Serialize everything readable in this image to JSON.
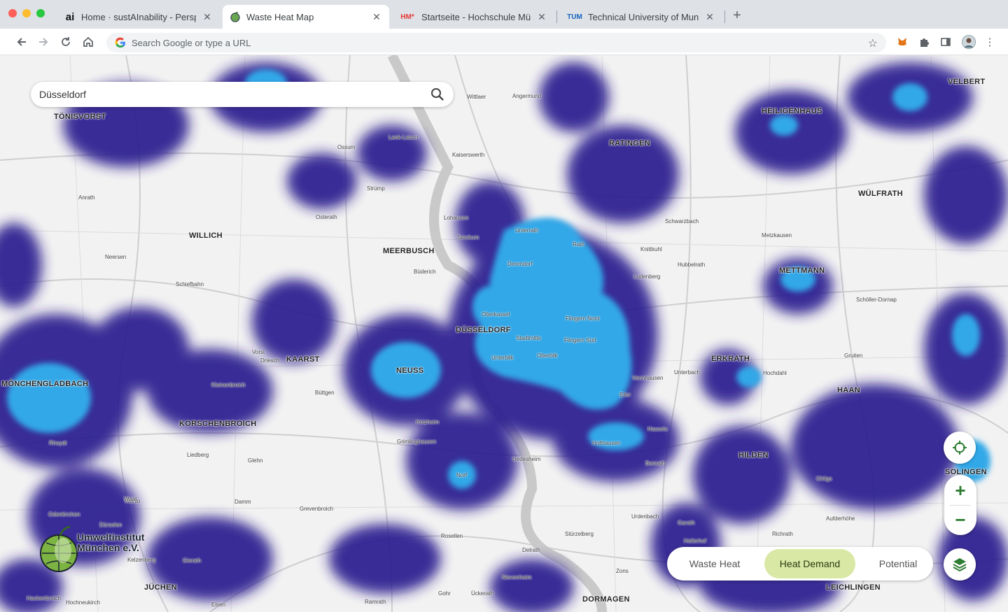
{
  "browser": {
    "tabs": [
      {
        "favicon": "ai",
        "title": "Home · sustAInability - Perspe",
        "active": false
      },
      {
        "favicon": "apple-icon",
        "title": "Waste Heat Map",
        "active": true
      },
      {
        "favicon": "HM*",
        "title": "Startseite - Hochschule Münc",
        "active": false
      },
      {
        "favicon": "TUM",
        "title": "Technical University of Munic",
        "active": false
      }
    ],
    "omnibox_placeholder": "Search Google or type a URL"
  },
  "map": {
    "search_value": "Düsseldorf",
    "places": [
      {
        "label": "TÖNISVORST",
        "cls": "big"
      },
      {
        "label": "WILLICH",
        "cls": "big"
      },
      {
        "label": "MEERBUSCH",
        "cls": "big"
      },
      {
        "label": "DÜSSELDORF",
        "cls": "big"
      },
      {
        "label": "NEUSS",
        "cls": "big"
      },
      {
        "label": "KAARST",
        "cls": "big"
      },
      {
        "label": "MÖNCHENGLADBACH",
        "cls": "big"
      },
      {
        "label": "KORSCHENBROICH",
        "cls": "big"
      },
      {
        "label": "RATINGEN",
        "cls": "big"
      },
      {
        "label": "HEILIGENHAUS",
        "cls": "big"
      },
      {
        "label": "VELBERT",
        "cls": "big"
      },
      {
        "label": "WÜLFRATH",
        "cls": "big"
      },
      {
        "label": "METTMANN",
        "cls": "big"
      },
      {
        "label": "ERKRATH",
        "cls": "big"
      },
      {
        "label": "HAAN",
        "cls": "big"
      },
      {
        "label": "HILDEN",
        "cls": "big"
      },
      {
        "label": "SOLINGEN",
        "cls": "big"
      },
      {
        "label": "LEICHLINGEN",
        "cls": "big"
      },
      {
        "label": "DORMAGEN",
        "cls": "big"
      },
      {
        "label": "JÜCHEN",
        "cls": "big"
      },
      {
        "label": "Unterrath",
        "cls": "small"
      },
      {
        "label": "Rath",
        "cls": "small"
      },
      {
        "label": "Derendorf",
        "cls": "small"
      },
      {
        "label": "Flingern Nord",
        "cls": "small"
      },
      {
        "label": "Flingern Süd",
        "cls": "small"
      },
      {
        "label": "Stadtmitte",
        "cls": "small"
      },
      {
        "label": "Oberbilk",
        "cls": "small"
      },
      {
        "label": "Unterbilk",
        "cls": "small"
      },
      {
        "label": "Oberkassel",
        "cls": "small"
      },
      {
        "label": "Lohausen",
        "cls": "small"
      },
      {
        "label": "Stockum",
        "cls": "small"
      },
      {
        "label": "Kaiserswerth",
        "cls": "small"
      },
      {
        "label": "Angermund",
        "cls": "small"
      },
      {
        "label": "Wittlaer",
        "cls": "small"
      },
      {
        "label": "Benrath",
        "cls": "small"
      },
      {
        "label": "Holthausen",
        "cls": "small"
      },
      {
        "label": "Hassels",
        "cls": "small"
      },
      {
        "label": "Eller",
        "cls": "small"
      },
      {
        "label": "Vennhausen",
        "cls": "small"
      },
      {
        "label": "Unterbach",
        "cls": "small"
      },
      {
        "label": "Grevenbroich",
        "cls": "small"
      },
      {
        "label": "Hochneukirch",
        "cls": "small"
      },
      {
        "label": "Schwarzbach",
        "cls": "small"
      },
      {
        "label": "Hubbelrath",
        "cls": "small"
      },
      {
        "label": "Ludenberg",
        "cls": "small"
      },
      {
        "label": "Knittkuhl",
        "cls": "small"
      },
      {
        "label": "Metzkausen",
        "cls": "small"
      },
      {
        "label": "Schöller-Dornap",
        "cls": "small"
      },
      {
        "label": "Gruiten",
        "cls": "small"
      },
      {
        "label": "Hochdahl",
        "cls": "small"
      },
      {
        "label": "Ohligs",
        "cls": "small"
      },
      {
        "label": "Aufderhöhe",
        "cls": "small"
      },
      {
        "label": "Richrath",
        "cls": "small"
      },
      {
        "label": "Garath",
        "cls": "small"
      },
      {
        "label": "Urdenbach",
        "cls": "small"
      },
      {
        "label": "Hellerhof",
        "cls": "small"
      },
      {
        "label": "Zons",
        "cls": "small"
      },
      {
        "label": "Stürzelberg",
        "cls": "small"
      },
      {
        "label": "Delrath",
        "cls": "small"
      },
      {
        "label": "Uedesheim",
        "cls": "small"
      },
      {
        "label": "Grimlinghausen",
        "cls": "small"
      },
      {
        "label": "Norf",
        "cls": "small"
      },
      {
        "label": "Rosellen",
        "cls": "small"
      },
      {
        "label": "Holzheim",
        "cls": "small"
      },
      {
        "label": "Glehn",
        "cls": "small"
      },
      {
        "label": "Büttgen",
        "cls": "small"
      },
      {
        "label": "Vorst",
        "cls": "small"
      },
      {
        "label": "Driesch",
        "cls": "small"
      },
      {
        "label": "Kleinenbroich",
        "cls": "small"
      },
      {
        "label": "Liedberg",
        "cls": "small"
      },
      {
        "label": "Lank-Latum",
        "cls": "small"
      },
      {
        "label": "Ossum",
        "cls": "small"
      },
      {
        "label": "Strümp",
        "cls": "small"
      },
      {
        "label": "Osterath",
        "cls": "small"
      },
      {
        "label": "Büderich",
        "cls": "small"
      },
      {
        "label": "Anrath",
        "cls": "small"
      },
      {
        "label": "Neersen",
        "cls": "small"
      },
      {
        "label": "Schiefbahn",
        "cls": "small"
      },
      {
        "label": "Rheydt",
        "cls": "small"
      },
      {
        "label": "Odenkirchen",
        "cls": "small"
      },
      {
        "label": "Wanlo",
        "cls": "small"
      },
      {
        "label": "Kelzenberg",
        "cls": "small"
      },
      {
        "label": "Gierath",
        "cls": "small"
      },
      {
        "label": "Damm",
        "cls": "small"
      },
      {
        "label": "Waat",
        "cls": "small"
      },
      {
        "label": "Dürselen",
        "cls": "small"
      },
      {
        "label": "Elsen",
        "cls": "small"
      },
      {
        "label": "Ramrath",
        "cls": "small"
      },
      {
        "label": "Gohr",
        "cls": "small"
      },
      {
        "label": "Ückerath",
        "cls": "small"
      },
      {
        "label": "Nievenheim",
        "cls": "small"
      },
      {
        "label": "Hackenbroich",
        "cls": "small"
      }
    ],
    "logo_line1": "Umweltinstitut",
    "logo_line2": "München e.V.",
    "modes": [
      {
        "label": "Waste Heat",
        "active": false
      },
      {
        "label": "Heat Demand",
        "active": true
      },
      {
        "label": "Potential",
        "active": false
      }
    ],
    "zoom_in": "+",
    "zoom_out": "−"
  }
}
